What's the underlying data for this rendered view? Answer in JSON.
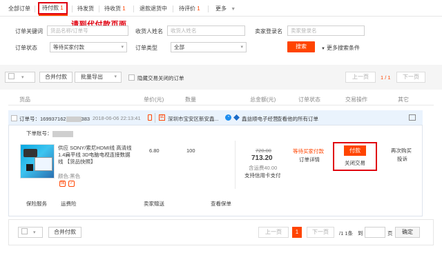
{
  "tabs": [
    {
      "label": "全部订单",
      "count": ""
    },
    {
      "label": "待付款",
      "count": "1"
    },
    {
      "label": "待发货",
      "count": ""
    },
    {
      "label": "待收货",
      "count": "1"
    },
    {
      "label": "退款退货中",
      "count": ""
    },
    {
      "label": "待评价",
      "count": "1"
    },
    {
      "label": "更多",
      "count": ""
    }
  ],
  "annotation": "请到代付款页面",
  "search": {
    "order_keyword_label": "订单关键词",
    "order_keyword_placeholder": "货品名称/订单号",
    "receiver_label": "收货人姓名",
    "receiver_placeholder": "收货人姓名",
    "seller_label": "卖家登录名",
    "seller_placeholder": "卖家登录名",
    "status_label": "订单状态",
    "status_value": "等待买家付款",
    "type_label": "订单类型",
    "type_value": "全部",
    "search_button": "搜索",
    "more_conditions": "更多搜索条件"
  },
  "toolbar": {
    "merge_pay": "合并付款",
    "batch_export": "批量导出",
    "hide_closed": "隐藏交易关闭的订单",
    "prev": "上一页",
    "page": "1 / 1",
    "next": "下一页"
  },
  "columns": [
    "货品",
    "单价(元)",
    "数量",
    "总金额(元)",
    "订单状态",
    "交易操作",
    "其它"
  ],
  "order": {
    "order_no_label": "订单号：",
    "order_no_prefix": "169937162",
    "order_no_suffix": "383",
    "datetime": "2018-06-06 22:13:41",
    "seller": "深圳市宝安区新安鑫...",
    "store": "鑫益顺电子经营",
    "view_all": "查看他的所有订单",
    "sub_account_label": "下单账号：",
    "product_title": "供应 SONY/索尼HDMI线 高清线 1.4扁平线 3D电脑电视连接数据线 【货品快照】",
    "color": "颜色:黑色",
    "unit_price": "6.80",
    "quantity": "100",
    "original_total": "720.00",
    "total": "713.20",
    "shipping": "含运费40.00",
    "credit_card": "支持信用卡支付",
    "status": "等待买家付款",
    "details": "订单详情",
    "pay_button": "付款",
    "close_trade": "关闭交易",
    "rebuy": "再次购买",
    "complain": "投诉",
    "insurance": "保险服务",
    "shipping_insurance": "运费险",
    "seller_gift": "卖家赠送",
    "view_policy": "查看保单"
  },
  "footer": {
    "merge_pay": "合并付款",
    "prev": "上一页",
    "page_number": "1",
    "next": "下一页",
    "total_pages": "/1 1条",
    "goto_label": "到",
    "page_label": "页",
    "confirm": "确定"
  },
  "colors": {
    "accent": "#ff4400",
    "annotation": "#e0000f",
    "link_blue": "#1e8ef0"
  }
}
